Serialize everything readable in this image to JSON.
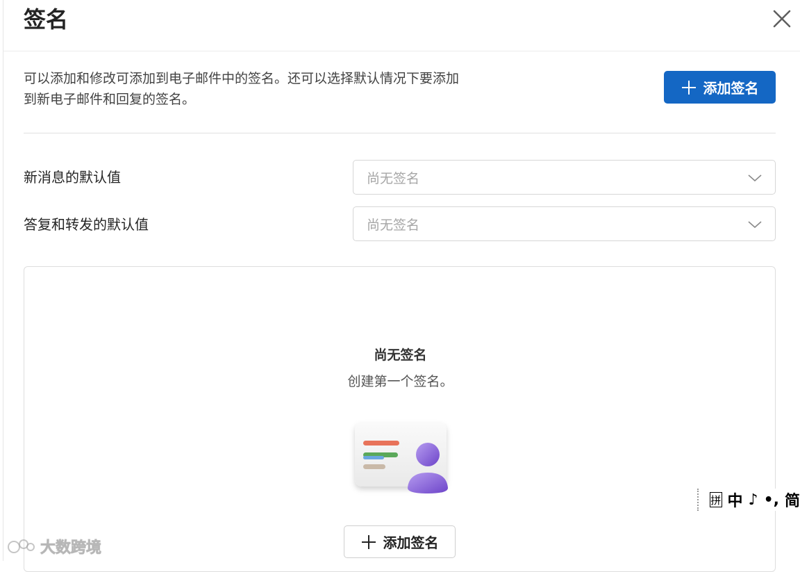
{
  "dialog": {
    "title": "签名",
    "intro": "可以添加和修改可添加到电子邮件中的签名。还可以选择默认情况下要添加到新电子邮件和回复的签名。",
    "add_button_label": "添加签名"
  },
  "defaults": {
    "new_message_label": "新消息的默认值",
    "new_message_value": "尚无签名",
    "reply_forward_label": "答复和转发的默认值",
    "reply_forward_value": "尚无签名"
  },
  "empty_state": {
    "title": "尚无签名",
    "subtitle": "创建第一个签名。",
    "add_button_label": "添加签名"
  },
  "ime_toolbar": {
    "mode_box": "拼",
    "lang": "中",
    "moon": "♪",
    "punct": "•,",
    "extra": "简"
  },
  "watermark": {
    "text": "大数跨境"
  },
  "colors": {
    "primary": "#1467c4",
    "avatar_purple": "#8a62d6"
  },
  "icons": [
    "close-icon",
    "plus-icon",
    "chevron-down-icon",
    "signature-card-illustration"
  ]
}
